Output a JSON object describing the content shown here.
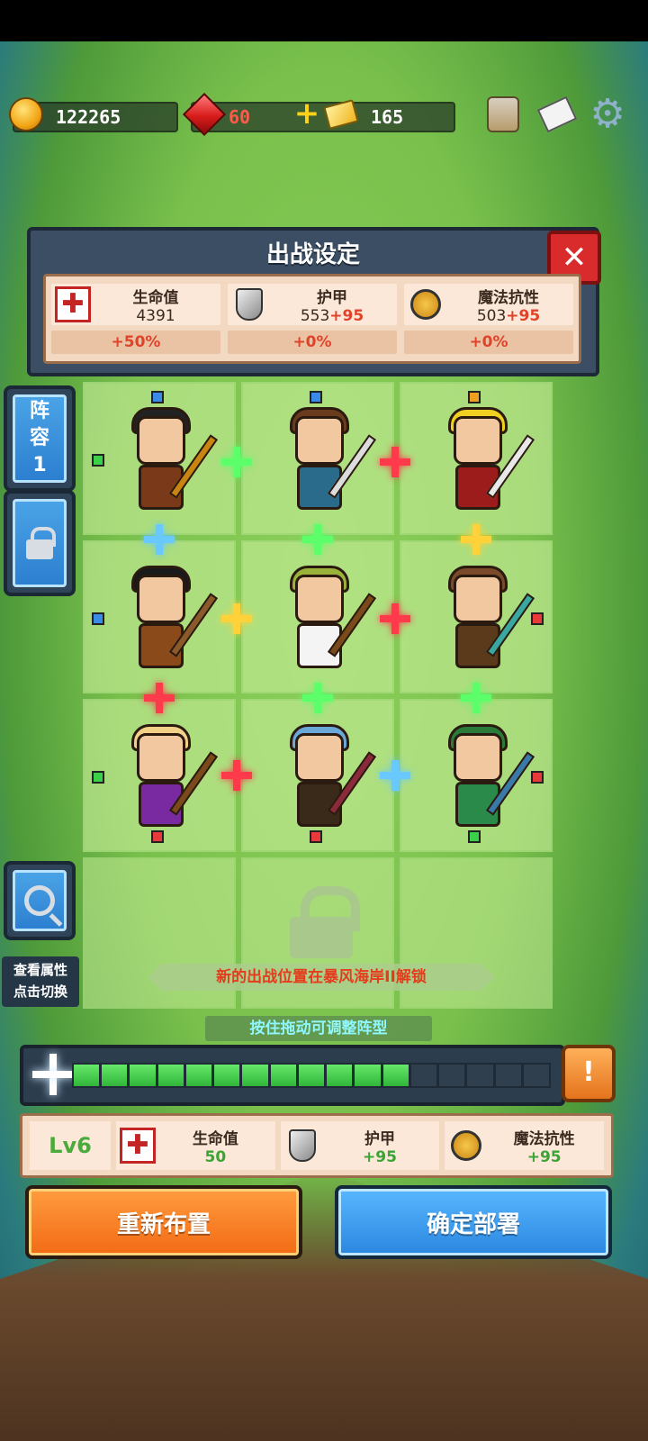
{
  "resources": {
    "coins": "122265",
    "gems": "60",
    "tickets": "165"
  },
  "icons": {
    "coin": "coin-icon",
    "gem": "gem-icon",
    "ticket": "ticket-icon",
    "add": "plus-icon",
    "character": "character-icon",
    "mail": "mail-icon",
    "settings": "gear-icon"
  },
  "panel": {
    "title": "出战设定",
    "close_label": "✕",
    "stats": [
      {
        "name": "生命值",
        "value": "4391",
        "bonus": "",
        "percent": "+50%",
        "icon": "hp-cross-icon"
      },
      {
        "name": "护甲",
        "value": "553",
        "bonus": "+95",
        "percent": "+0%",
        "icon": "armor-shield-icon"
      },
      {
        "name": "魔法抗性",
        "value": "503",
        "bonus": "+95",
        "percent": "+0%",
        "icon": "magic-resist-icon"
      }
    ]
  },
  "side": {
    "lineup_label": "阵容1",
    "view_caption_line1": "查看属性",
    "view_caption_line2": "点击切换"
  },
  "grid": {
    "unlock_text": "新的出战位置在暴风海岸II解锁",
    "drag_hint": "按住拖动可调整阵型",
    "heroes": [
      {
        "hair": "#222222",
        "body": "#7a3a1a"
      },
      {
        "hair": "#6b3b1e",
        "body": "#2a6a8a"
      },
      {
        "hair": "#f0d020",
        "body": "#9c1c1c"
      },
      {
        "hair": "#1a1a1a",
        "body": "#8a4a1a"
      },
      {
        "hair": "#9ab13a",
        "body": "#f4f4f4"
      },
      {
        "hair": "#7a4a2a",
        "body": "#5a3a1a"
      },
      {
        "hair": "#f2d088",
        "body": "#7a2aa0"
      },
      {
        "hair": "#6aa8d8",
        "body": "#3a2a1a"
      },
      {
        "hair": "#2a7a3a",
        "body": "#2a8a4a"
      }
    ]
  },
  "progress": {
    "filled": 12,
    "total": 17,
    "reward_label": "!"
  },
  "level": {
    "label": "Lv6",
    "stats": [
      {
        "name": "生命值",
        "value": "50",
        "icon": "hp-cross-icon"
      },
      {
        "name": "护甲",
        "value": "+95",
        "icon": "armor-shield-icon"
      },
      {
        "name": "魔法抗性",
        "value": "+95",
        "icon": "magic-resist-icon"
      }
    ]
  },
  "buttons": {
    "reset": "重新布置",
    "confirm": "确定部署"
  },
  "colors": {
    "accent_orange": "#f26a14",
    "accent_blue": "#2a86df",
    "bonus_red": "#e0432a",
    "level_green": "#3aa436"
  }
}
